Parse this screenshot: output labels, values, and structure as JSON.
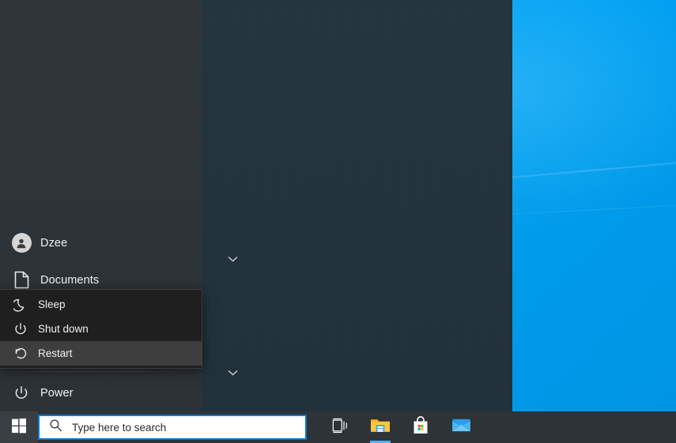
{
  "desktop": {
    "wallpaper_color": "#00a2f3",
    "name": "windows-default-wallpaper"
  },
  "start_menu": {
    "panel_bg": "#1f2a30",
    "rail_bg": "#2d3337",
    "tile_bg": "#22323b",
    "rail_items": [
      {
        "label": "Dzee",
        "icon": "user-avatar-icon"
      },
      {
        "label": "Documents",
        "icon": "document-icon"
      }
    ],
    "power_item": {
      "label": "Power",
      "icon": "power-icon"
    },
    "tile_group_chevrons": [
      {
        "icon": "chevron-down-icon"
      },
      {
        "icon": "chevron-down-icon"
      }
    ]
  },
  "power_menu": {
    "bg": "#1f1f1f",
    "border": "#3c3c3c",
    "hover_bg": "#3e3e3e",
    "items": [
      {
        "label": "Sleep",
        "icon": "moon-icon",
        "hovered": false
      },
      {
        "label": "Shut down",
        "icon": "power-icon",
        "hovered": false
      },
      {
        "label": "Restart",
        "icon": "restart-icon",
        "hovered": true
      }
    ]
  },
  "taskbar": {
    "bg": "#2d3337",
    "accent": "#0078d7",
    "start_button": {
      "icon": "windows-logo-icon",
      "label": "Start"
    },
    "search": {
      "placeholder": "Type here to search",
      "value": "",
      "icon": "search-icon",
      "focused": true
    },
    "buttons": [
      {
        "label": "Task View",
        "icon": "task-view-icon",
        "running": false
      },
      {
        "label": "File Explorer",
        "icon": "file-explorer-icon",
        "running": true
      },
      {
        "label": "Microsoft Store",
        "icon": "store-icon",
        "running": false
      },
      {
        "label": "Mail",
        "icon": "mail-icon",
        "running": false
      }
    ]
  }
}
